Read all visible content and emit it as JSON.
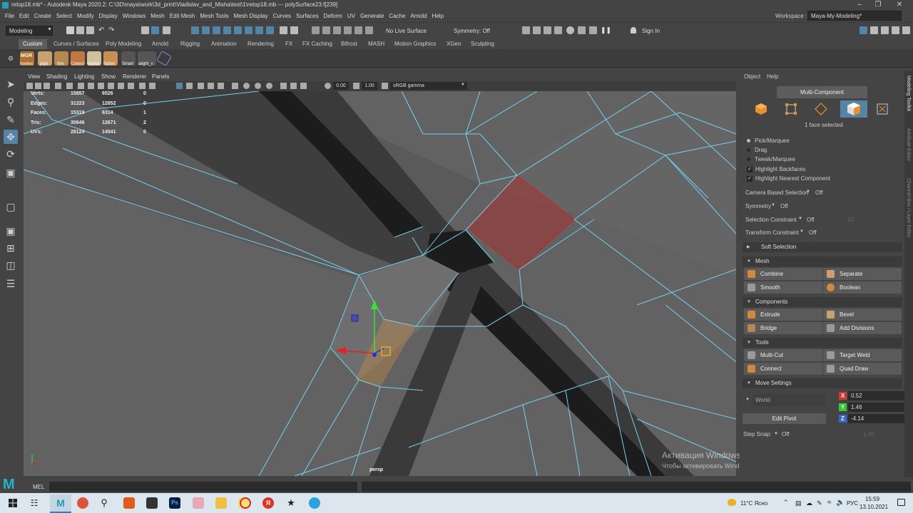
{
  "window": {
    "title": "retop18.mb* - Autodesk Maya 2020.2: C:\\3D\\maya\\work\\3d_print\\Vladislav_and_Misha\\test\\1\\retop18.mb   ---   polySurface23.f[239]"
  },
  "menu": [
    "File",
    "Edit",
    "Create",
    "Select",
    "Modify",
    "Display",
    "Windows",
    "Mesh",
    "Edit Mesh",
    "Mesh Tools",
    "Mesh Display",
    "Curves",
    "Surfaces",
    "Deform",
    "UV",
    "Generate",
    "Cache",
    "Arnold",
    "Help"
  ],
  "workspace": {
    "label": "Workspace :",
    "value": "Maya-My-Modeling*"
  },
  "statusline": {
    "mode": "Modeling",
    "live_surface": "No Live Surface",
    "symmetry": "Symmetry: Off",
    "sign_in": "Sign In"
  },
  "shelf": {
    "tabs": [
      "Custom",
      "Curves / Surfaces",
      "Poly Modeling",
      "Arnold",
      "Rigging",
      "Animation",
      "Rendering",
      "FX",
      "FX Caching",
      "Bifrost",
      "MASH",
      "Motion Graphics",
      "XGen",
      "Sculpting"
    ],
    "items": [
      {
        "label": "boolea",
        "color": "#b07030",
        "badge": "MGR"
      },
      {
        "label": "pipe",
        "color": "#c9a070"
      },
      {
        "label": "fine",
        "color": "#b58850"
      },
      {
        "label": "Conect",
        "color": "#c07840"
      },
      {
        "label": "viramk",
        "color": "#d0c0a0"
      },
      {
        "label": "flatten",
        "color": "#c89050"
      },
      {
        "label": "Smart",
        "color": "#555555"
      },
      {
        "label": "alight_v",
        "color": "#555555"
      },
      {
        "label": "",
        "color": "#7b5fc8"
      }
    ]
  },
  "viewport": {
    "menu": [
      "View",
      "Shading",
      "Lighting",
      "Show",
      "Renderer",
      "Panels"
    ],
    "exposure": "0.00",
    "gamma": "1.00",
    "colorspace": "sRGB gamma",
    "camera": "persp",
    "hud": [
      {
        "label": "Verts:",
        "total": "15857",
        "sel": "6526",
        "c": "0"
      },
      {
        "label": "Edges:",
        "total": "31223",
        "sel": "12852",
        "c": "0"
      },
      {
        "label": "Faces:",
        "total": "15319",
        "sel": "6314",
        "c": "1"
      },
      {
        "label": "Tris:",
        "total": "30646",
        "sel": "12671",
        "c": "2"
      },
      {
        "label": "UVs:",
        "total": "28124",
        "sel": "14541",
        "c": "0"
      }
    ],
    "watermark_title": "Активация Windows",
    "watermark_sub": "Чтобы активировать Windows, перейдите в раздел \"Параметры\"."
  },
  "modeling_toolkit": {
    "menu": [
      "Object",
      "Help"
    ],
    "mode_button": "Multi-Component",
    "selection_status": "1 face selected",
    "pick_options": [
      "Pick/Marquee",
      "Drag",
      "Tweak/Marquee"
    ],
    "checks": [
      "Highlight Backfaces",
      "Highlight Nearest Component"
    ],
    "camera_based": {
      "label": "Camera Based Selection",
      "value": "Off"
    },
    "symmetry": {
      "label": "Symmetry",
      "value": "Off"
    },
    "selection_constraint": {
      "label": "Selection Constraint",
      "value": "Off",
      "extra": "15"
    },
    "transform_constraint": {
      "label": "Transform Constraint",
      "value": "Off"
    },
    "soft_selection": "Soft Selection",
    "sections": {
      "mesh": {
        "title": "Mesh",
        "buttons": [
          "Combine",
          "Separate",
          "Smooth",
          "Boolean"
        ]
      },
      "components": {
        "title": "Components",
        "buttons": [
          "Extrude",
          "Bevel",
          "Bridge",
          "Add Divisions"
        ]
      },
      "tools": {
        "title": "Tools",
        "buttons": [
          "Multi-Cut",
          "Target Weld",
          "Connect",
          "Quad Draw"
        ]
      },
      "move": {
        "title": "Move Settings",
        "space": "World",
        "edit_pivot": "Edit Pivot",
        "x": "0.52",
        "y": "1.46",
        "z": "-4.14",
        "step_snap": {
          "label": "Step Snap:",
          "value": "Off",
          "amount": "1.00"
        }
      }
    },
    "side_tabs": [
      "Modeling Toolkit",
      "Attribute Editor",
      "Channel Box / Layer Editor"
    ]
  },
  "command": {
    "label": "MEL"
  },
  "taskbar": {
    "weather": "11°C  Ясно",
    "lang": "РУС",
    "time": "15:59",
    "date": "13.10.2021"
  },
  "colors": {
    "accent": "#5285a6",
    "wire": "#6fd3ef",
    "selection": "#d11a1a"
  }
}
